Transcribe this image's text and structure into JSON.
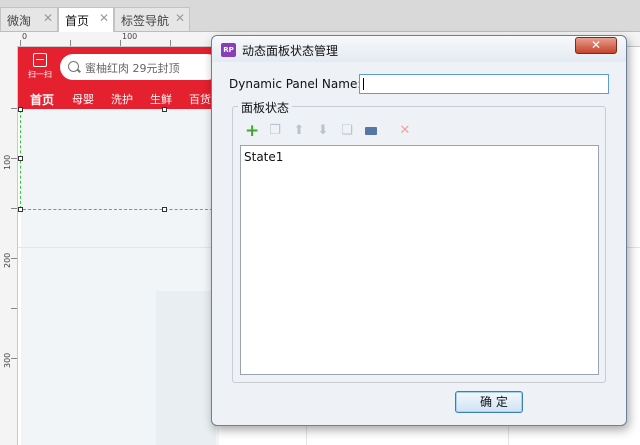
{
  "tabs": [
    {
      "label": "微淘",
      "close": "✕"
    },
    {
      "label": "首页",
      "close": "✕"
    },
    {
      "label": "标签导航",
      "close": "✕"
    }
  ],
  "ruler": {
    "h_labels": [
      "0",
      "100"
    ],
    "v_labels": [
      "100",
      "200",
      "300"
    ]
  },
  "mobile": {
    "scan_label": "扫一扫",
    "search_placeholder": "蜜柚红肉 29元封顶",
    "nav": [
      "首页",
      "母婴",
      "洗护",
      "生鲜",
      "百货"
    ],
    "brand_color": "#e5202f"
  },
  "dialog": {
    "icon_text": "RP",
    "title": "动态面板状态管理",
    "close": "✕",
    "name_label": "Dynamic Panel Name:",
    "name_value": "",
    "group_label": "面板状态",
    "toolbar": [
      "add-icon",
      "duplicate-icon",
      "move-up-icon",
      "move-down-icon",
      "copy-icon",
      "edit-icon",
      "delete-icon"
    ],
    "states": [
      "State1"
    ],
    "ok_label": "确 定"
  }
}
